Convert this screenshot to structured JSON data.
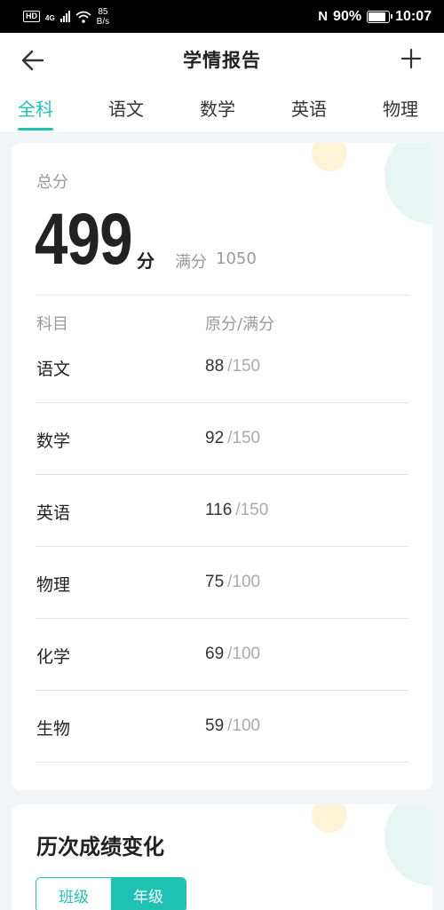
{
  "status_bar": {
    "hd": "HD",
    "network": "4G",
    "speed_value": "85",
    "speed_unit": "B/s",
    "nfc": "N",
    "battery": "90%",
    "battery_level": 0.9,
    "time": "10:07"
  },
  "nav": {
    "title": "学情报告",
    "back_icon": "arrow-left-icon",
    "add_icon": "plus-icon"
  },
  "tabs": [
    {
      "label": "全科",
      "active": true
    },
    {
      "label": "语文",
      "active": false
    },
    {
      "label": "数学",
      "active": false
    },
    {
      "label": "英语",
      "active": false
    },
    {
      "label": "物理",
      "active": false
    }
  ],
  "summary": {
    "total_label": "总分",
    "score": "499",
    "score_unit": "分",
    "full_label": "满分",
    "full_value": "1050"
  },
  "table": {
    "col_subject": "科目",
    "col_score": "原分/满分",
    "rows": [
      {
        "subject": "语文",
        "raw": "88",
        "max": "/150"
      },
      {
        "subject": "数学",
        "raw": "92",
        "max": "/150"
      },
      {
        "subject": "英语",
        "raw": "116",
        "max": "/150"
      },
      {
        "subject": "物理",
        "raw": "75",
        "max": "/100"
      },
      {
        "subject": "化学",
        "raw": "69",
        "max": "/100"
      },
      {
        "subject": "生物",
        "raw": "59",
        "max": "/100"
      }
    ]
  },
  "history": {
    "title": "历次成绩变化",
    "toggle": [
      {
        "label": "班级",
        "active": false
      },
      {
        "label": "年级",
        "active": true
      }
    ]
  },
  "colors": {
    "accent": "#1fc1b3",
    "text_primary": "#222222",
    "text_secondary": "#999999"
  }
}
